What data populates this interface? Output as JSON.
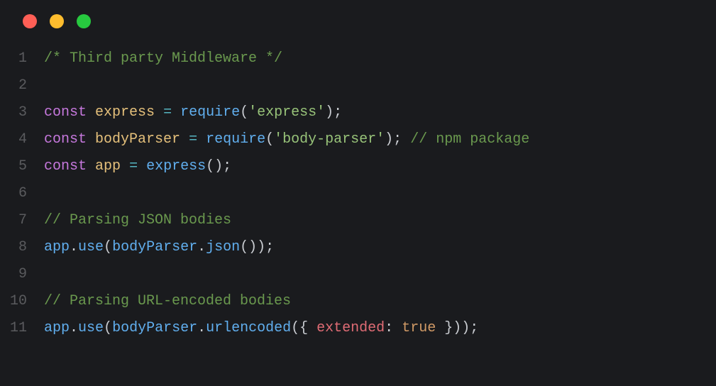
{
  "window": {
    "traffic_lights": [
      "close",
      "minimize",
      "zoom"
    ]
  },
  "colors": {
    "red": "#ff5f56",
    "yellow": "#ffbd2e",
    "green": "#27c93f",
    "background": "#1a1b1e"
  },
  "lines": [
    {
      "num": "1",
      "tokens": [
        {
          "cls": "tk-comment",
          "t": "/* Third party Middleware */"
        }
      ]
    },
    {
      "num": "2",
      "tokens": []
    },
    {
      "num": "3",
      "tokens": [
        {
          "cls": "tk-keyword",
          "t": "const"
        },
        {
          "cls": "tk-plain",
          "t": " "
        },
        {
          "cls": "tk-var",
          "t": "express"
        },
        {
          "cls": "tk-plain",
          "t": " "
        },
        {
          "cls": "tk-op",
          "t": "="
        },
        {
          "cls": "tk-plain",
          "t": " "
        },
        {
          "cls": "tk-func",
          "t": "require"
        },
        {
          "cls": "tk-punct",
          "t": "("
        },
        {
          "cls": "tk-string",
          "t": "'express'"
        },
        {
          "cls": "tk-punct",
          "t": ");"
        }
      ]
    },
    {
      "num": "4",
      "tokens": [
        {
          "cls": "tk-keyword",
          "t": "const"
        },
        {
          "cls": "tk-plain",
          "t": " "
        },
        {
          "cls": "tk-var",
          "t": "bodyParser"
        },
        {
          "cls": "tk-plain",
          "t": " "
        },
        {
          "cls": "tk-op",
          "t": "="
        },
        {
          "cls": "tk-plain",
          "t": " "
        },
        {
          "cls": "tk-func",
          "t": "require"
        },
        {
          "cls": "tk-punct",
          "t": "("
        },
        {
          "cls": "tk-string",
          "t": "'body-parser'"
        },
        {
          "cls": "tk-punct",
          "t": "); "
        },
        {
          "cls": "tk-comment",
          "t": "// npm package"
        }
      ]
    },
    {
      "num": "5",
      "tokens": [
        {
          "cls": "tk-keyword",
          "t": "const"
        },
        {
          "cls": "tk-plain",
          "t": " "
        },
        {
          "cls": "tk-var",
          "t": "app"
        },
        {
          "cls": "tk-plain",
          "t": " "
        },
        {
          "cls": "tk-op",
          "t": "="
        },
        {
          "cls": "tk-plain",
          "t": " "
        },
        {
          "cls": "tk-func",
          "t": "express"
        },
        {
          "cls": "tk-punct",
          "t": "();"
        }
      ]
    },
    {
      "num": "6",
      "tokens": []
    },
    {
      "num": "7",
      "tokens": [
        {
          "cls": "tk-comment",
          "t": "// Parsing JSON bodies"
        }
      ]
    },
    {
      "num": "8",
      "tokens": [
        {
          "cls": "tk-ident",
          "t": "app"
        },
        {
          "cls": "tk-punct",
          "t": "."
        },
        {
          "cls": "tk-func",
          "t": "use"
        },
        {
          "cls": "tk-punct",
          "t": "("
        },
        {
          "cls": "tk-ident",
          "t": "bodyParser"
        },
        {
          "cls": "tk-punct",
          "t": "."
        },
        {
          "cls": "tk-func",
          "t": "json"
        },
        {
          "cls": "tk-punct",
          "t": "());"
        }
      ]
    },
    {
      "num": "9",
      "tokens": []
    },
    {
      "num": "10",
      "tokens": [
        {
          "cls": "tk-comment",
          "t": "// Parsing URL-encoded bodies"
        }
      ]
    },
    {
      "num": "11",
      "tokens": [
        {
          "cls": "tk-ident",
          "t": "app"
        },
        {
          "cls": "tk-punct",
          "t": "."
        },
        {
          "cls": "tk-func",
          "t": "use"
        },
        {
          "cls": "tk-punct",
          "t": "("
        },
        {
          "cls": "tk-ident",
          "t": "bodyParser"
        },
        {
          "cls": "tk-punct",
          "t": "."
        },
        {
          "cls": "tk-func",
          "t": "urlencoded"
        },
        {
          "cls": "tk-punct",
          "t": "({ "
        },
        {
          "cls": "tk-prop",
          "t": "extended"
        },
        {
          "cls": "tk-punct",
          "t": ": "
        },
        {
          "cls": "tk-bool",
          "t": "true"
        },
        {
          "cls": "tk-punct",
          "t": " }));"
        }
      ]
    }
  ]
}
